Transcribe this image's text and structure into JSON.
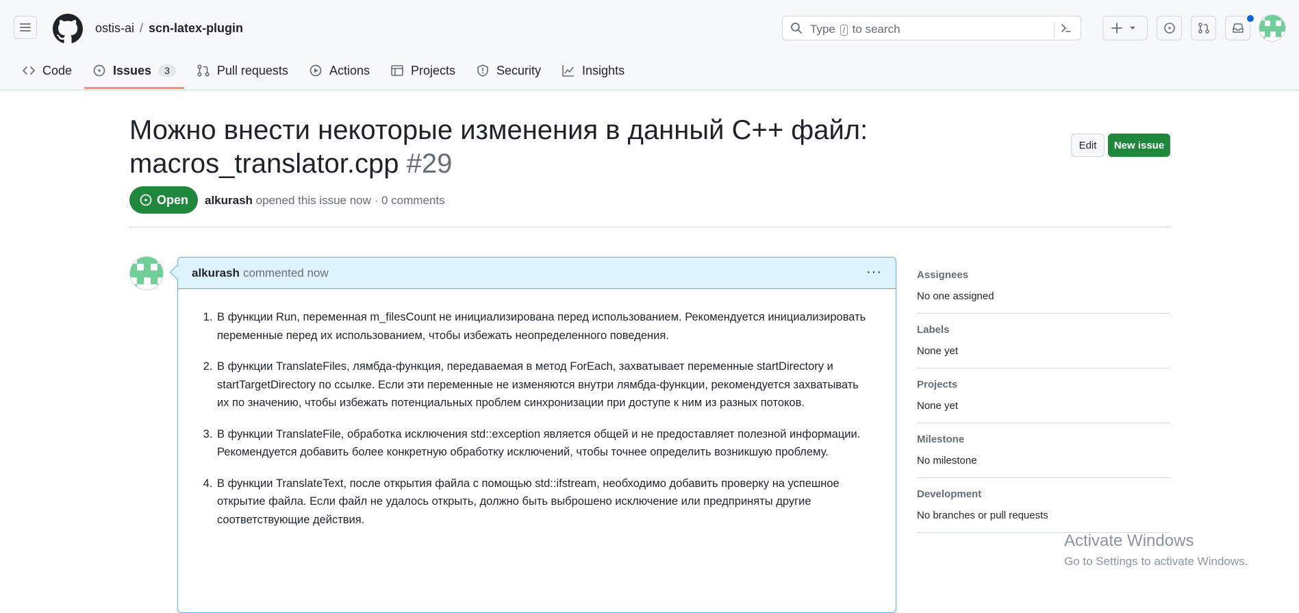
{
  "header": {
    "owner": "ostis-ai",
    "separator": "/",
    "repo": "scn-latex-plugin",
    "search_before": "Type",
    "search_key": "/",
    "search_after": "to search"
  },
  "tabs": [
    {
      "label": "Code"
    },
    {
      "label": "Issues",
      "count": "3"
    },
    {
      "label": "Pull requests"
    },
    {
      "label": "Actions"
    },
    {
      "label": "Projects"
    },
    {
      "label": "Security"
    },
    {
      "label": "Insights"
    }
  ],
  "issue": {
    "title": "Можно внести некоторые изменения в данный C++ файл: macros_translator.cpp",
    "number": "#29",
    "state": "Open",
    "author": "alkurash",
    "meta": "opened this issue now · 0 comments",
    "edit_label": "Edit",
    "new_label": "New issue"
  },
  "comment": {
    "author": "alkurash",
    "time": "commented now",
    "items": [
      "В функции Run, переменная m_filesCount не инициализирована перед использованием. Рекомендуется инициализировать переменные перед их использованием, чтобы избежать неопределенного поведения.",
      "В функции TranslateFiles, лямбда-функция, передаваемая в метод ForEach, захватывает переменные startDirectory и startTargetDirectory по ссылке. Если эти переменные не изменяются внутри лямбда-функции, рекомендуется захватывать их по значению, чтобы избежать потенциальных проблем синхронизации при доступе к ним из разных потоков.",
      "В функции TranslateFile, обработка исключения std::exception является общей и не предоставляет полезной информации. Рекомендуется добавить более конкретную обработку исключений, чтобы точнее определить возникшую проблему.",
      "В функции TranslateText, после открытия файла с помощью std::ifstream, необходимо добавить проверку на успешное открытие файла. Если файл не удалось открыть, должно быть выброшено исключение или предприняты другие соответствующие действия."
    ]
  },
  "sidebar": [
    {
      "heading": "Assignees",
      "value": "No one assigned"
    },
    {
      "heading": "Labels",
      "value": "None yet"
    },
    {
      "heading": "Projects",
      "value": "None yet"
    },
    {
      "heading": "Milestone",
      "value": "No milestone"
    },
    {
      "heading": "Development",
      "value": "No branches or pull requests"
    }
  ],
  "watermark": {
    "line1": "Activate Windows",
    "line2": "Go to Settings to activate Windows."
  },
  "colors": {
    "accent_green": "#1f883d",
    "tab_underline": "#fd8c73",
    "comment_header": "#ddf4ff",
    "notification_dot": "#0969da"
  }
}
